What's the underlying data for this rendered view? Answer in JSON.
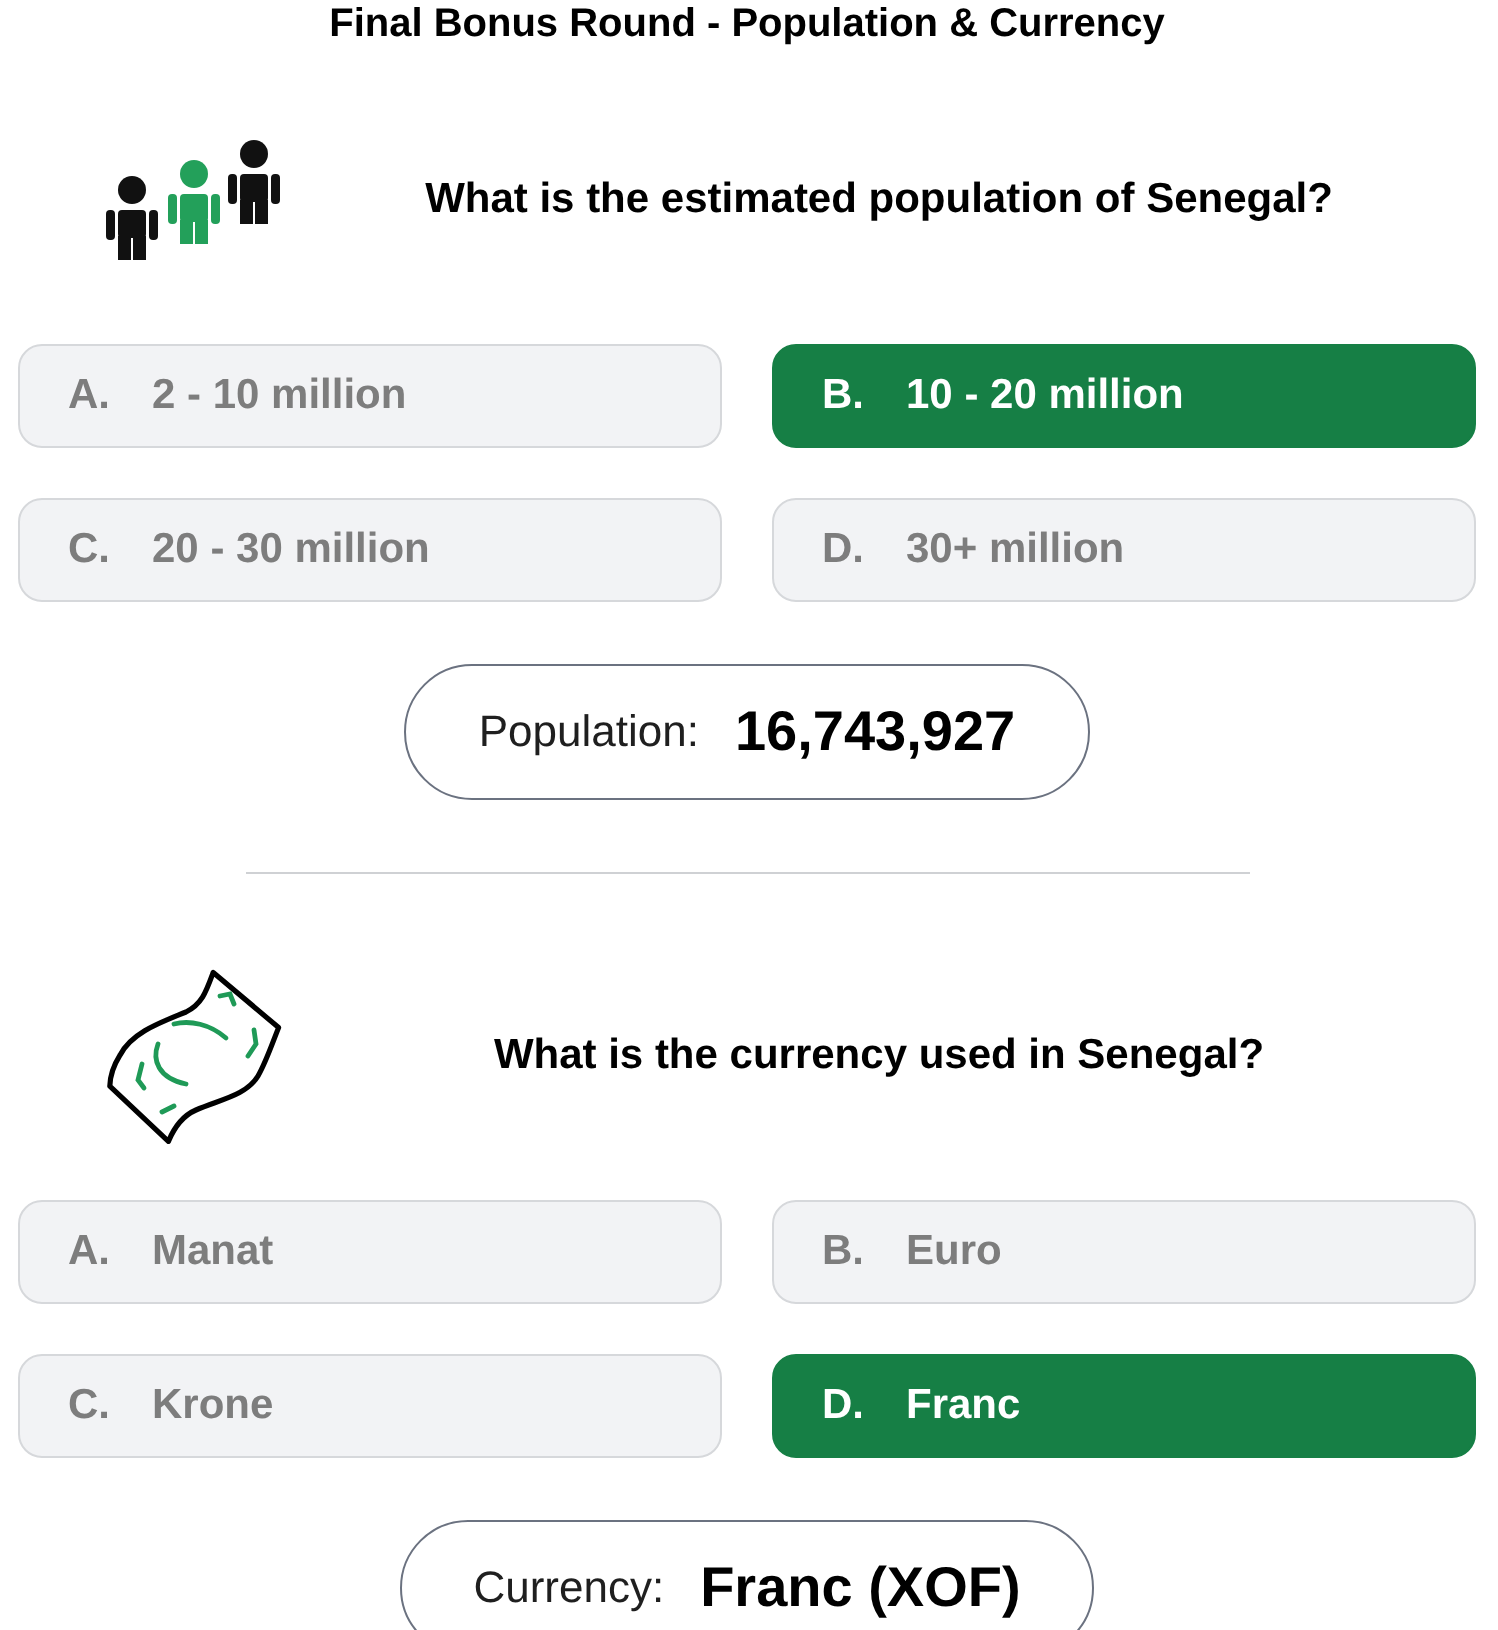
{
  "title": "Final Bonus Round - Population & Currency",
  "questions": [
    {
      "kind": "population",
      "question": "What is the estimated population of Senegal?",
      "options": [
        {
          "letter": "A.",
          "text": "2 - 10 million",
          "selected": false
        },
        {
          "letter": "B.",
          "text": "10 - 20 million",
          "selected": true
        },
        {
          "letter": "C.",
          "text": "20 - 30 million",
          "selected": false
        },
        {
          "letter": "D.",
          "text": "30+ million",
          "selected": false
        }
      ],
      "answer": {
        "label": "Population:",
        "value": "16,743,927"
      }
    },
    {
      "kind": "currency",
      "question": "What is the currency used in Senegal?",
      "options": [
        {
          "letter": "A.",
          "text": "Manat",
          "selected": false
        },
        {
          "letter": "B.",
          "text": "Euro",
          "selected": false
        },
        {
          "letter": "C.",
          "text": "Krone",
          "selected": false
        },
        {
          "letter": "D.",
          "text": "Franc",
          "selected": true
        }
      ],
      "answer": {
        "label": "Currency:",
        "value": "Franc (XOF)"
      }
    }
  ]
}
